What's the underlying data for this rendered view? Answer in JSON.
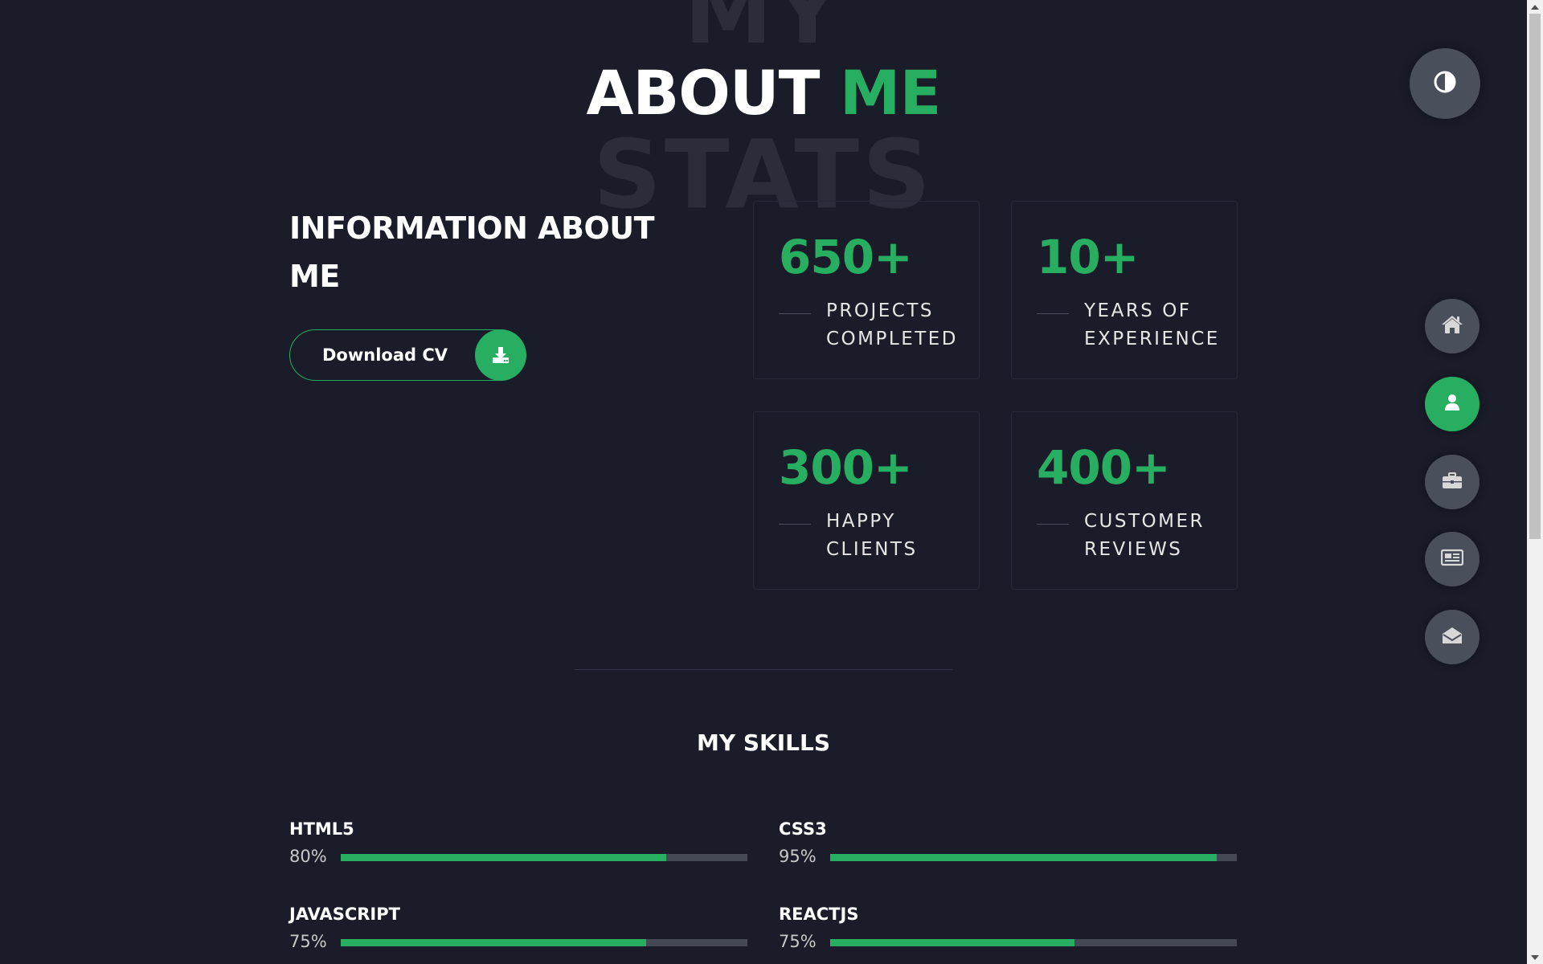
{
  "header": {
    "bg_word_top": "MY",
    "bg_word_bottom": "STATS",
    "title_main": "ABOUT ",
    "title_accent": "ME"
  },
  "info": {
    "title": "INFORMATION ABOUT ME",
    "download_label": "Download CV"
  },
  "stats": [
    {
      "value": "650+",
      "label": "PROJECTS COMPLETED"
    },
    {
      "value": "10+",
      "label": "YEARS OF EXPERIENCE"
    },
    {
      "value": "300+",
      "label": "HAPPY CLIENTS"
    },
    {
      "value": "400+",
      "label": "CUSTOMER REVIEWS"
    }
  ],
  "skills": {
    "title": "MY SKILLS",
    "items": [
      {
        "name": "HTML5",
        "percent_label": "80%",
        "percent": 80
      },
      {
        "name": "CSS3",
        "percent_label": "95%",
        "percent": 95
      },
      {
        "name": "JAVASCRIPT",
        "percent_label": "75%",
        "percent": 75
      },
      {
        "name": "REACTJS",
        "percent_label": "75%",
        "percent": 60
      }
    ]
  },
  "controls": {
    "theme_icon": "contrast-icon",
    "nav": [
      {
        "icon": "home-icon",
        "active": false
      },
      {
        "icon": "user-icon",
        "active": true
      },
      {
        "icon": "briefcase-icon",
        "active": false
      },
      {
        "icon": "newspaper-icon",
        "active": false
      },
      {
        "icon": "envelope-open-icon",
        "active": false
      }
    ]
  },
  "colors": {
    "background": "#1a1c2a",
    "accent": "#27ae60",
    "button_gray": "#4a4f5c",
    "track_gray": "#444955"
  }
}
